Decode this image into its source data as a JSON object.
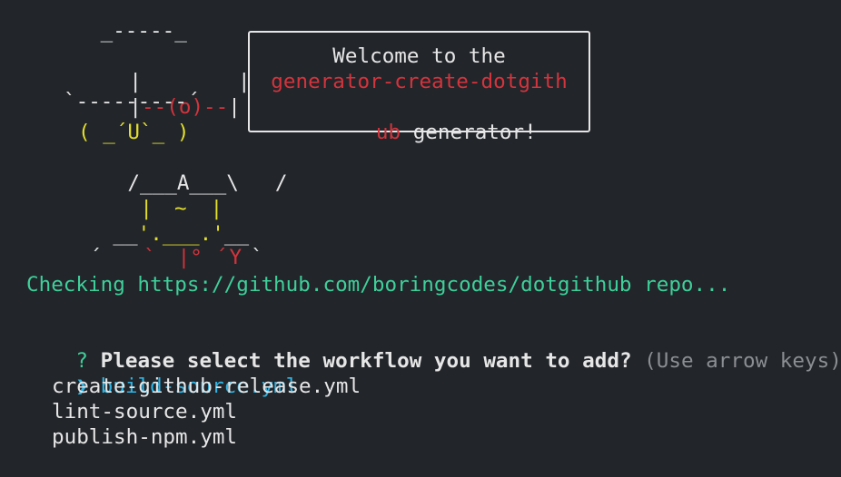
{
  "mascot": {
    "line1": " _-----_ ",
    "line2_left": "|",
    "line2_right": "|",
    "line3_bar1": "|",
    "line3_eye": "--(o)--",
    "line3_bar2": "|",
    "line4": "`---------´",
    "line5": "( _´U`_ )",
    "line6": "/___A___\\",
    "line6_slash": "/",
    "line7_left": "|",
    "line7_nose": "~",
    "line7_right": "|",
    "line8_left": "__",
    "line8_mid": "'.___.'",
    "line8_right": "__",
    "line9_a": "´",
    "line9_b": "`",
    "line9_c": "|°",
    "line9_d": "´",
    "line9_e": "Y",
    "line9_f": "`"
  },
  "welcome": {
    "line1": "Welcome to the",
    "line2": "generator-create-dotgith",
    "line3_red": "ub",
    "line3_rest": " generator!"
  },
  "status": {
    "checking": "Checking https://github.com/boringcodes/dotgithub repo..."
  },
  "prompt": {
    "qmark": "?",
    "question": "Please select the workflow you want to add?",
    "hint": "(Use arrow keys)",
    "pointer": "❯",
    "options": [
      "build-source.yml",
      "create-github-release.yml",
      "lint-source.yml",
      "publish-npm.yml"
    ],
    "selected_index": 0
  },
  "colors": {
    "background": "#22252a",
    "text": "#e6e6e6",
    "red": "#d3343c",
    "yellow": "#e3df2b",
    "green": "#3ed09a",
    "cyan": "#2fb4e3",
    "dim": "#8b8e93"
  }
}
